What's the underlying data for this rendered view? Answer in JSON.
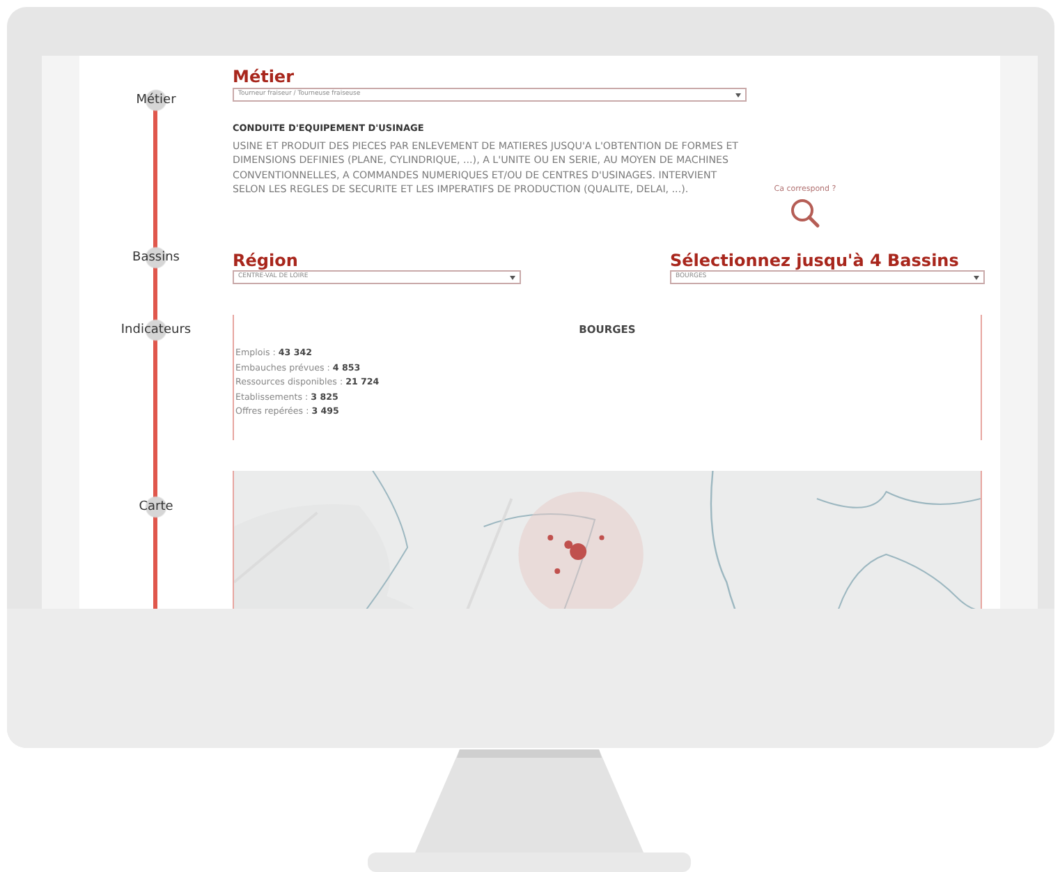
{
  "screen": {
    "timeline": [
      {
        "label": "Métier"
      },
      {
        "label": "Bassins"
      },
      {
        "label": "Indicateurs"
      },
      {
        "label": "Carte"
      }
    ],
    "metier": {
      "title": "Métier",
      "select_value": "Tourneur fraiseur / Tourneuse fraiseuse",
      "heading": "CONDUITE D'EQUIPEMENT D'USINAGE",
      "description": "USINE ET PRODUIT DES PIECES PAR ENLEVEMENT DE MATIERES JUSQU'A L'OBTENTION DE FORMES ET DIMENSIONS DEFINIES (PLANE, CYLINDRIQUE, ...), A L'UNITE OU EN SERIE, AU MOYEN DE MACHINES CONVENTIONNELLES, A COMMANDES NUMERIQUES ET/OU DE CENTRES D'USINAGES. INTERVIENT SELON LES REGLES DE SECURITE ET LES IMPERATIFS DE PRODUCTION (QUALITE, DELAI, ...).",
      "match_link": "Ca correspond ?"
    },
    "region": {
      "title": "Région",
      "select_value": "CENTRE-VAL DE LOIRE"
    },
    "bassins": {
      "title": "Sélectionnez jusqu'à 4 Bassins",
      "select_value": "BOURGES"
    },
    "indicators": {
      "title": "BOURGES",
      "items": [
        {
          "text": "Emplois : **43 342**"
        },
        {
          "text": "Embauches prévues : **4 853**"
        },
        {
          "text": "Ressources disponibles : **21 724**"
        },
        {
          "text": "Etablissements : **3 825**"
        },
        {
          "text": "Offres repérées : **3 495**"
        }
      ]
    }
  }
}
